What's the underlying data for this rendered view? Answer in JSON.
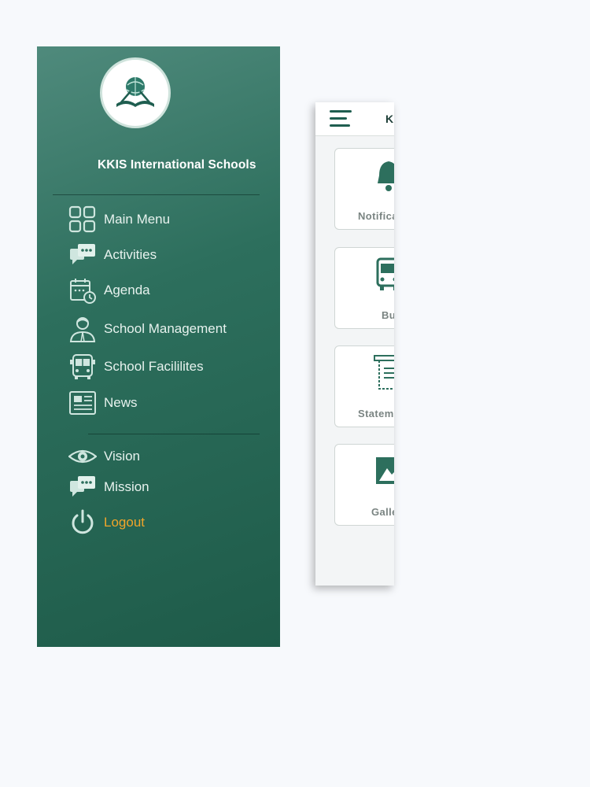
{
  "drawer": {
    "school_name": "KKIS International Schools",
    "menu": [
      {
        "label": "Main Menu",
        "icon": "grid-icon"
      },
      {
        "label": "Activities",
        "icon": "chat-bubbles-icon"
      },
      {
        "label": "Agenda",
        "icon": "calendar-clock-icon"
      },
      {
        "label": "School Management",
        "icon": "person-icon"
      },
      {
        "label": "School Facililites",
        "icon": "bus-icon"
      },
      {
        "label": "News",
        "icon": "newspaper-icon"
      }
    ],
    "secondary": [
      {
        "label": "Vision",
        "icon": "eye-icon"
      },
      {
        "label": "Mission",
        "icon": "chat-bubbles-icon"
      }
    ],
    "logout": {
      "label": "Logout",
      "icon": "power-icon",
      "color": "#f0a52a"
    }
  },
  "app": {
    "header_title": "KKIS",
    "cards": [
      {
        "label": "Notifications",
        "icon": "bell-icon"
      },
      {
        "label": "Bus",
        "icon": "bus-icon"
      },
      {
        "label": "Statement",
        "icon": "receipt-icon"
      },
      {
        "label": "Gallery",
        "icon": "image-icon"
      }
    ]
  },
  "colors": {
    "drawer_top": "#4f8a7c",
    "drawer_bottom": "#1e5b49",
    "accent_orange": "#f0a52a",
    "icon_green": "#1f5e50"
  }
}
